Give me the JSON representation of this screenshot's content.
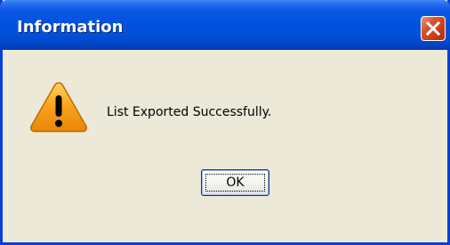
{
  "dialog": {
    "title": "Information",
    "message": "List Exported Successfully.",
    "icon": "warning-icon",
    "ok_label": "OK",
    "close_icon": "close-icon"
  },
  "colors": {
    "title_bar": "#0053e0",
    "window_border": "#0a3fd6",
    "dialog_background": "#ece9d8",
    "close_button": "#d9542c",
    "warning_fill": "#f7a21b",
    "warning_mark": "#000000"
  }
}
